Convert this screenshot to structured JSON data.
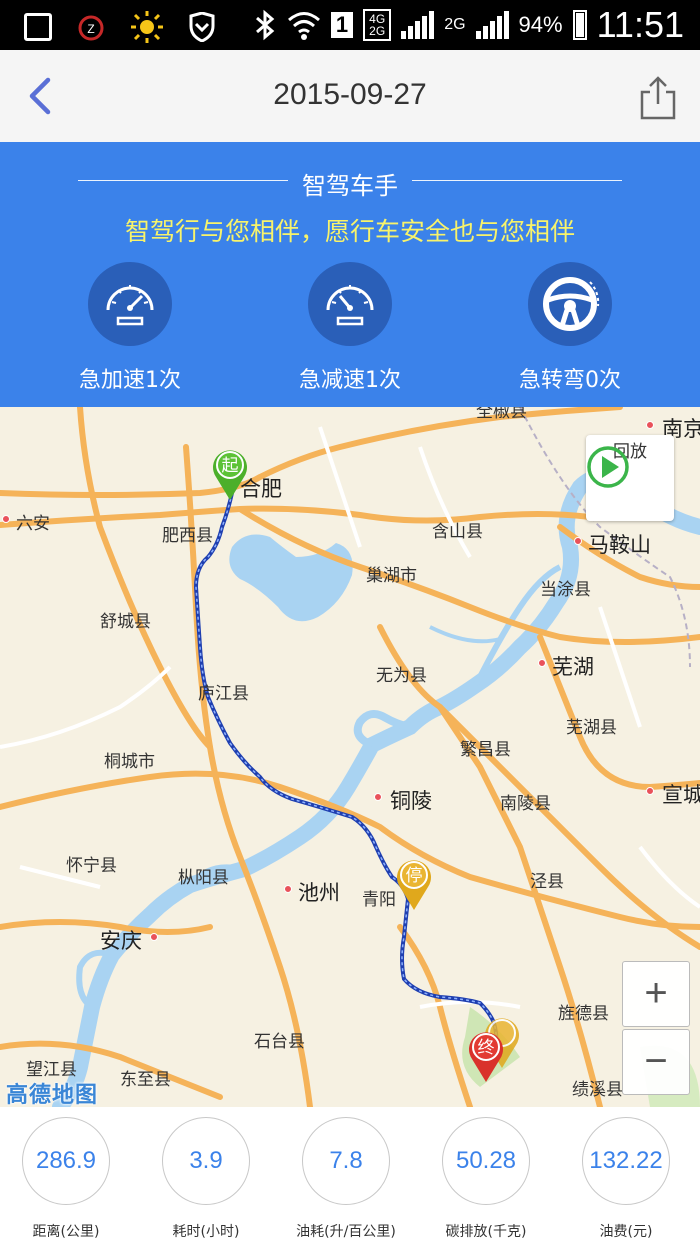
{
  "status_bar": {
    "battery": "94%",
    "time": "11:51",
    "sim": "1",
    "net_top": "4G",
    "net_bottom": "2G",
    "net2": "2G"
  },
  "header": {
    "title": "2015-09-27",
    "back_icon": "chevron-left-icon",
    "share_icon": "share-icon"
  },
  "banner": {
    "title": "智驾车手",
    "subtitle": "智驾行与您相伴，愿行车安全也与您相伴",
    "stats": [
      {
        "label": "急加速1次",
        "icon": "speedometer-icon"
      },
      {
        "label": "急减速1次",
        "icon": "speedometer-icon"
      },
      {
        "label": "急转弯0次",
        "icon": "steering-wheel-icon"
      }
    ]
  },
  "map": {
    "replay_label": "回放",
    "zoom_in": "+",
    "zoom_out": "−",
    "logo": "高德地图",
    "pins": {
      "start": "起",
      "stop": "停",
      "end": "终"
    },
    "cities": [
      {
        "name": "六安"
      },
      {
        "name": "合肥",
        "big": true
      },
      {
        "name": "肥西县"
      },
      {
        "name": "含山县"
      },
      {
        "name": "南京",
        "big": true
      },
      {
        "name": "马鞍山",
        "big": true
      },
      {
        "name": "巢湖市"
      },
      {
        "name": "当涂县"
      },
      {
        "name": "舒城县"
      },
      {
        "name": "无为县"
      },
      {
        "name": "芜湖",
        "big": true
      },
      {
        "name": "庐江县"
      },
      {
        "name": "芜湖县"
      },
      {
        "name": "桐城市"
      },
      {
        "name": "繁昌县"
      },
      {
        "name": "铜陵",
        "big": true
      },
      {
        "name": "南陵县"
      },
      {
        "name": "宣城",
        "big": true
      },
      {
        "name": "怀宁县"
      },
      {
        "name": "枞阳县"
      },
      {
        "name": "池州",
        "big": true
      },
      {
        "name": "青阳"
      },
      {
        "name": "泾县"
      },
      {
        "name": "安庆",
        "big": true
      },
      {
        "name": "旌德县"
      },
      {
        "name": "石台县"
      },
      {
        "name": "望江县"
      },
      {
        "name": "东至县"
      },
      {
        "name": "绩溪县"
      },
      {
        "name": "全椒县"
      }
    ]
  },
  "metrics": [
    {
      "value": "286.9",
      "label": "距离(公里)"
    },
    {
      "value": "3.9",
      "label": "耗时(小时)"
    },
    {
      "value": "7.8",
      "label": "油耗(升/百公里)"
    },
    {
      "value": "50.28",
      "label": "碳排放(千克)"
    },
    {
      "value": "132.22",
      "label": "油费(元)"
    }
  ],
  "colors": {
    "banner": "#3b82ea",
    "accent_text": "#f8f36a",
    "route": "#1f3fb0",
    "start_pin": "#4caf2a",
    "stop_pin": "#e0a81c",
    "end_pin": "#d9322b"
  }
}
